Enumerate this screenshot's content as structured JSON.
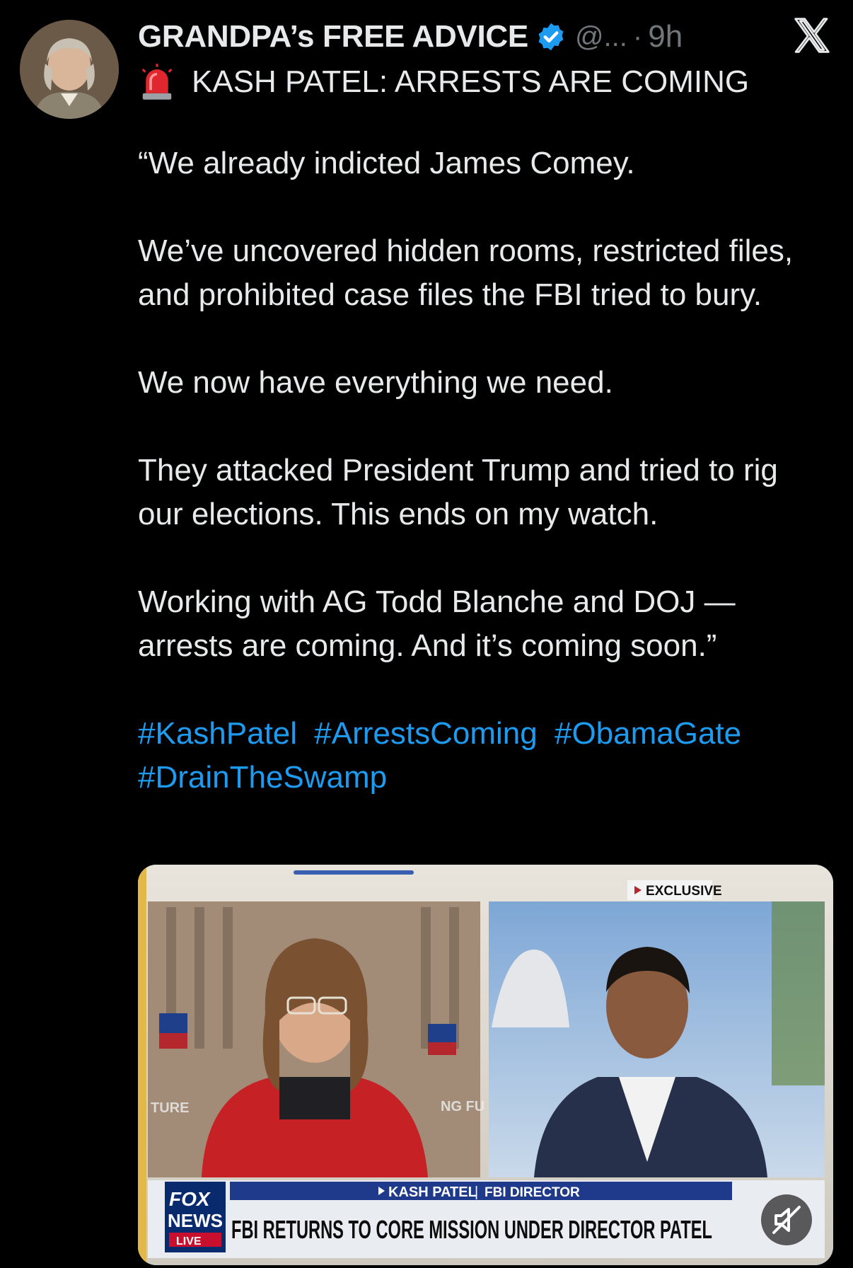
{
  "tweet": {
    "display_name": "GRANDPA’s FREE ADVICE",
    "handle": "@...",
    "separator": "·",
    "age": "9h",
    "headline": "KASH PATEL: ARRESTS ARE COMING",
    "paragraphs": [
      "“We already indicted James Comey.",
      "We’ve uncovered hidden rooms, restricted files, and prohibited case files the FBI tried to bury.",
      "We now have everything we need.",
      "They attacked President Trump and tried to rig our elections. This ends on my watch.",
      "Working with AG Todd Blanche and DOJ — arrests are coming. And it’s coming soon.”"
    ],
    "hashtags": [
      "#KashPatel",
      "#ArrestsComing",
      "#ObamaGate",
      "#DrainTheSwamp"
    ]
  },
  "media": {
    "exclusive_label": "EXCLUSIVE",
    "partial_text_left": "TURE",
    "partial_text_right": "NG FU",
    "network_line1": "FOX",
    "network_line2": "NEWS",
    "network_line3": "LIVE",
    "lower_third_name": "KASH PATEL",
    "lower_third_role": "FBI DIRECTOR",
    "lower_third_headline": "FBI RETURNS TO CORE MISSION UNDER DIRECTOR PATEL"
  },
  "icons": {
    "verified": "verified-badge-icon",
    "x_logo": "x-logo-icon",
    "siren": "siren-emoji-icon",
    "mute": "mute-icon"
  },
  "colors": {
    "background": "#000000",
    "text": "#e7e9ea",
    "muted": "#71767b",
    "link": "#1d9bf0",
    "verified": "#1d9bf0"
  }
}
